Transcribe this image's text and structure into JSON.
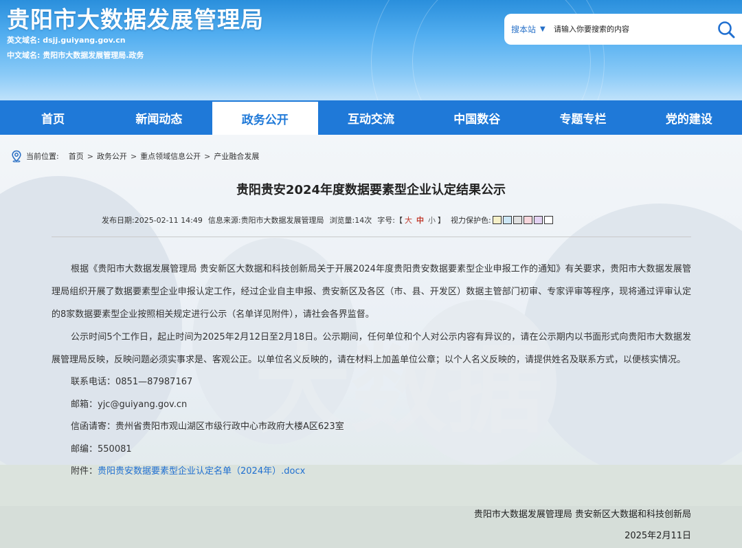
{
  "header": {
    "site_title": "贵阳市大数据发展管理局",
    "en_domain_label": "英文域名:",
    "en_domain_value": "dsjj.guiyang.gov.cn",
    "cn_domain_label": "中文域名:",
    "cn_domain_value": "贵阳市大数据发展管理局.政务"
  },
  "search": {
    "scope": "搜本站",
    "placeholder": "请输入你要搜索的内容",
    "icon": "search-icon"
  },
  "nav": {
    "items": [
      {
        "label": "首页",
        "active": false
      },
      {
        "label": "新闻动态",
        "active": false
      },
      {
        "label": "政务公开",
        "active": true
      },
      {
        "label": "互动交流",
        "active": false
      },
      {
        "label": "中国数谷",
        "active": false
      },
      {
        "label": "专题专栏",
        "active": false
      },
      {
        "label": "党的建设",
        "active": false
      }
    ]
  },
  "breadcrumb": {
    "label": "当前位置:",
    "items": [
      "首页",
      "政务公开",
      "重点领域信息公开",
      "产业融合发展"
    ],
    "separator": ">"
  },
  "article": {
    "title": "贵阳贵安2024年度数据要素型企业认定结果公示",
    "meta": {
      "publish_label": "发布日期:",
      "publish_date": "2025-02-11 14:49",
      "source_label": "信息来源:",
      "source": "贵阳市大数据发展管理局",
      "views_label": "浏览量:",
      "views": "14次",
      "font_label": "字号:",
      "font_open": "【",
      "font_big": "大",
      "font_mid": "中",
      "font_small": "小",
      "font_close": "】",
      "eye_label": "视力保护色:",
      "swatches": [
        "#f5f0c8",
        "#cce6f5",
        "#e0e0e0",
        "#f7d6dc",
        "#e3d2f2",
        "#ffffff"
      ]
    },
    "paragraphs": [
      "根据《贵阳市大数据发展管理局 贵安新区大数据和科技创新局关于开展2024年度贵阳贵安数据要素型企业申报工作的通知》有关要求，贵阳市大数据发展管理局组织开展了数据要素型企业申报认定工作，经过企业自主申报、贵安新区及各区（市、县、开发区）数据主管部门初审、专家评审等程序，现将通过评审认定的8家数据要素型企业按照相关规定进行公示（名单详见附件），请社会各界监督。",
      "公示时间5个工作日，起止时间为2025年2月12日至2月18日。公示期间，任何单位和个人对公示内容有异议的，请在公示期内以书面形式向贵阳市大数据发展管理局反映，反映问题必须实事求是、客观公正。以单位名义反映的，请在材料上加盖单位公章；以个人名义反映的，请提供姓名及联系方式，以便核实情况。"
    ],
    "contact_phone": "联系电话：0851—87987167",
    "email": "邮箱：yjc@guiyang.gov.cn",
    "address": "信函请寄：贵州省贵阳市观山湖区市级行政中心市政府大楼A区623室",
    "postcode": "邮编：550081",
    "attachment_label": "附件：",
    "attachment_link": "贵阳贵安数据要素型企业认定名单（2024年）.docx",
    "signature": "贵阳市大数据发展管理局 贵安新区大数据和科技创新局",
    "sign_date": "2025年2月11日"
  }
}
